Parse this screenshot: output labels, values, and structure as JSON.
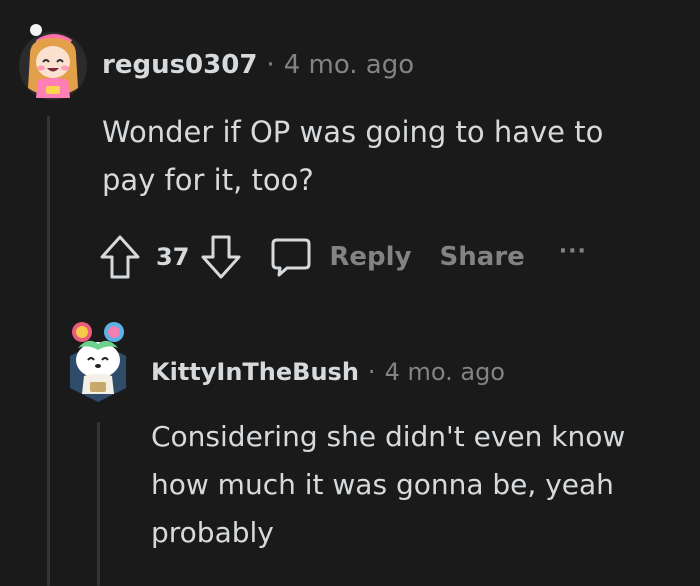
{
  "comments": [
    {
      "username": "regus0307",
      "separator": "·",
      "time": "4 mo. ago",
      "body_lines": [
        "Wonder if OP was going to have to",
        "pay for it, too?"
      ],
      "score": "37",
      "reply_label": "Reply",
      "share_label": "Share",
      "more_label": "···"
    },
    {
      "username": "KittyInTheBush",
      "separator": "·",
      "time": "4 mo. ago",
      "body_lines": [
        "Considering she didn't even know",
        "how much it was gonna be, yeah",
        "probably"
      ]
    }
  ],
  "colors": {
    "background": "#1a1a1b",
    "text": "#d7dadc",
    "muted": "#818384",
    "thread_line": "#343536"
  }
}
